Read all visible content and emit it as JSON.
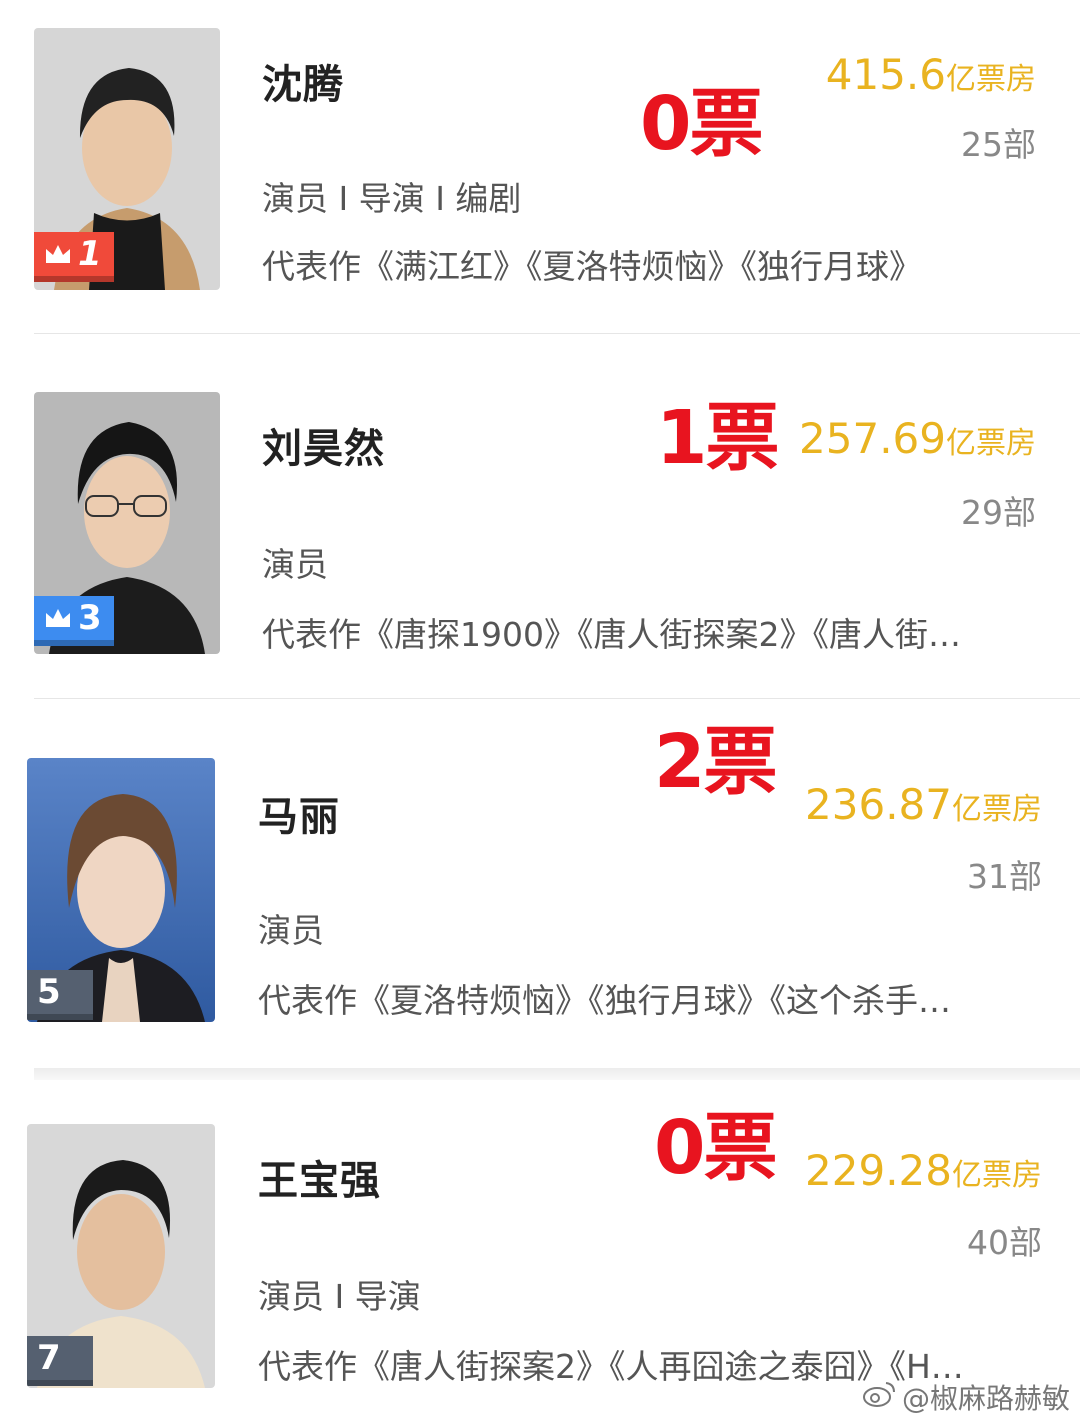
{
  "people": [
    {
      "name": "沈腾",
      "rank": "1",
      "rank_color": "#f04a3a",
      "votes": "0票",
      "box_office_value": "415.6",
      "box_office_unit": "亿票房",
      "films": "25部",
      "roles": "演员 I 导演 I 编剧",
      "works": "代表作《满江红》《夏洛特烦恼》《独行月球》",
      "has_crown": true
    },
    {
      "name": "刘昊然",
      "rank": "3",
      "rank_color": "#3d8cf0",
      "votes": "1票",
      "box_office_value": "257.69",
      "box_office_unit": "亿票房",
      "films": "29部",
      "roles": "演员",
      "works": "代表作《唐探1900》《唐人街探案2》《唐人街…",
      "has_crown": true
    },
    {
      "name": "马丽",
      "rank": "5",
      "rank_color": "#556070",
      "votes": "2票",
      "box_office_value": "236.87",
      "box_office_unit": "亿票房",
      "films": "31部",
      "roles": "演员",
      "works": "代表作《夏洛特烦恼》《独行月球》《这个杀手…",
      "has_crown": false
    },
    {
      "name": "王宝强",
      "rank": "7",
      "rank_color": "#556070",
      "votes": "0票",
      "box_office_value": "229.28",
      "box_office_unit": "亿票房",
      "films": "40部",
      "roles": "演员 I 导演",
      "works": "代表作《唐人街探案2》《人再囧途之泰囧》《H…",
      "has_crown": false
    }
  ],
  "watermark": "@椒麻路赫敏",
  "colors": {
    "vote_red": "#e8141f",
    "box_office_gold": "#e9b320"
  }
}
